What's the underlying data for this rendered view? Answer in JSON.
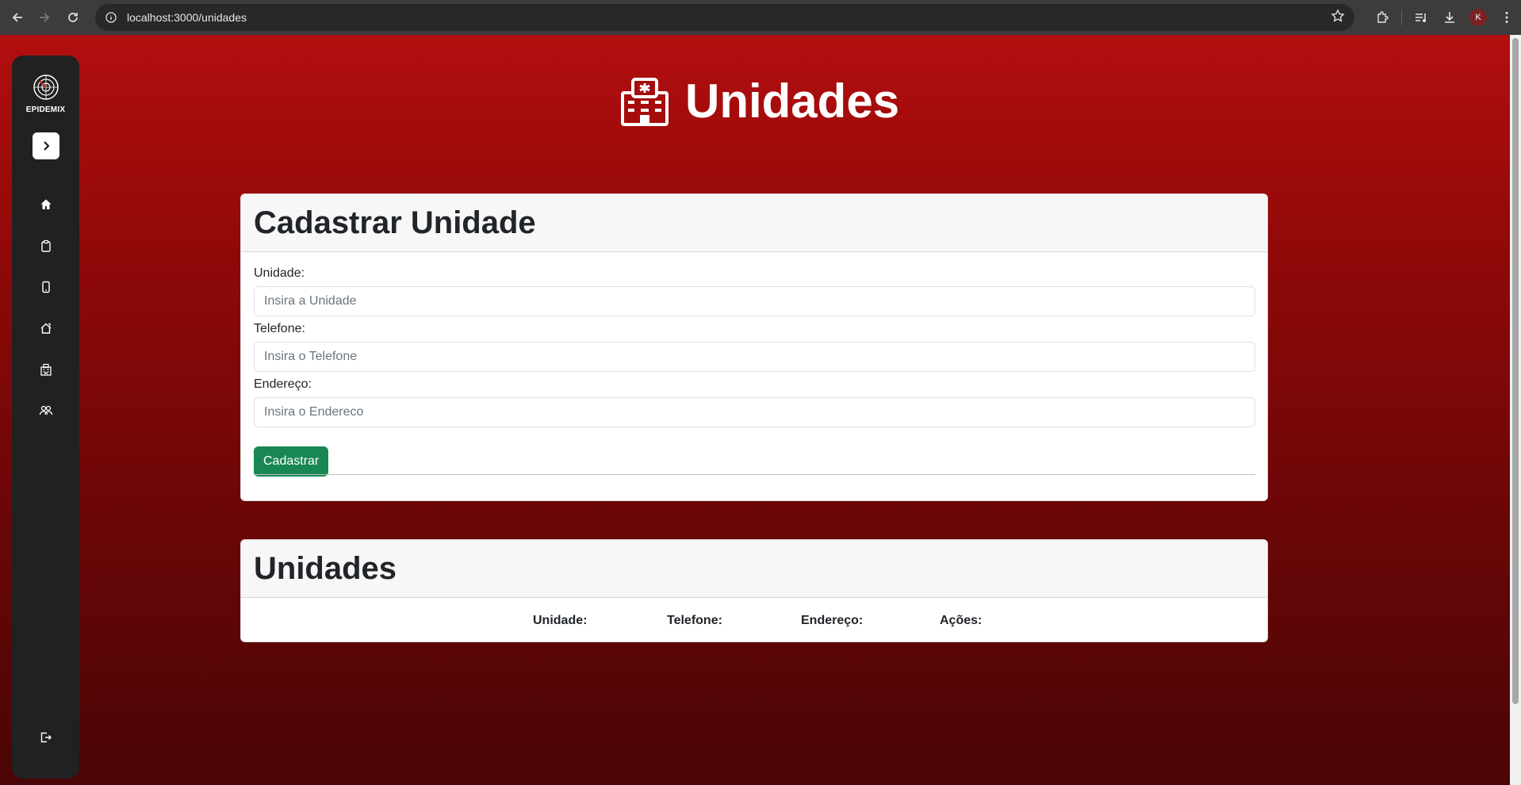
{
  "browser": {
    "url": "localhost:3000/unidades",
    "profile_initial": "K"
  },
  "sidebar": {
    "brand": "EPIDEMIX",
    "items": [
      {
        "icon": "home-icon"
      },
      {
        "icon": "clipboard-icon"
      },
      {
        "icon": "smartphone-icon"
      },
      {
        "icon": "house-icon"
      },
      {
        "icon": "hospital-icon"
      },
      {
        "icon": "users-icon"
      }
    ],
    "logout_icon": "logout-icon"
  },
  "page": {
    "title": "Unidades"
  },
  "form_card": {
    "title": "Cadastrar Unidade",
    "fields": [
      {
        "label": "Unidade:",
        "placeholder": "Insira a Unidade",
        "value": ""
      },
      {
        "label": "Telefone:",
        "placeholder": "Insira o Telefone",
        "value": ""
      },
      {
        "label": "Endereço:",
        "placeholder": "Insira o Endereco",
        "value": ""
      }
    ],
    "submit_label": "Cadastrar"
  },
  "list_card": {
    "title": "Unidades",
    "columns": [
      "Unidade:",
      "Telefone:",
      "Endereço:",
      "Ações:"
    ],
    "rows": []
  },
  "colors": {
    "accent_green": "#198754",
    "sidebar_bg": "#212121",
    "page_gradient_top": "#b20e0e",
    "page_gradient_bottom": "#4a0506"
  }
}
